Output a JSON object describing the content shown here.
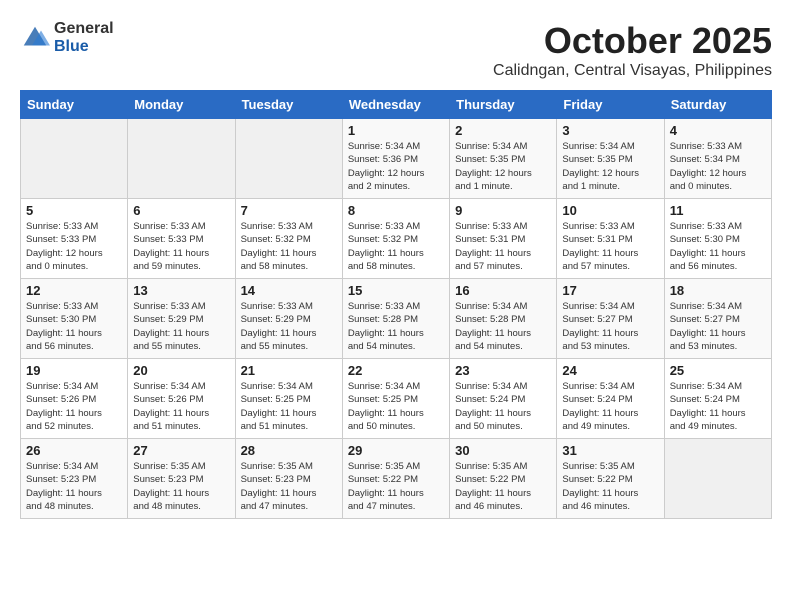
{
  "header": {
    "logo_general": "General",
    "logo_blue": "Blue",
    "month": "October 2025",
    "location": "Calidngan, Central Visayas, Philippines"
  },
  "weekdays": [
    "Sunday",
    "Monday",
    "Tuesday",
    "Wednesday",
    "Thursday",
    "Friday",
    "Saturday"
  ],
  "weeks": [
    [
      {
        "day": "",
        "info": ""
      },
      {
        "day": "",
        "info": ""
      },
      {
        "day": "",
        "info": ""
      },
      {
        "day": "1",
        "info": "Sunrise: 5:34 AM\nSunset: 5:36 PM\nDaylight: 12 hours\nand 2 minutes."
      },
      {
        "day": "2",
        "info": "Sunrise: 5:34 AM\nSunset: 5:35 PM\nDaylight: 12 hours\nand 1 minute."
      },
      {
        "day": "3",
        "info": "Sunrise: 5:34 AM\nSunset: 5:35 PM\nDaylight: 12 hours\nand 1 minute."
      },
      {
        "day": "4",
        "info": "Sunrise: 5:33 AM\nSunset: 5:34 PM\nDaylight: 12 hours\nand 0 minutes."
      }
    ],
    [
      {
        "day": "5",
        "info": "Sunrise: 5:33 AM\nSunset: 5:33 PM\nDaylight: 12 hours\nand 0 minutes."
      },
      {
        "day": "6",
        "info": "Sunrise: 5:33 AM\nSunset: 5:33 PM\nDaylight: 11 hours\nand 59 minutes."
      },
      {
        "day": "7",
        "info": "Sunrise: 5:33 AM\nSunset: 5:32 PM\nDaylight: 11 hours\nand 58 minutes."
      },
      {
        "day": "8",
        "info": "Sunrise: 5:33 AM\nSunset: 5:32 PM\nDaylight: 11 hours\nand 58 minutes."
      },
      {
        "day": "9",
        "info": "Sunrise: 5:33 AM\nSunset: 5:31 PM\nDaylight: 11 hours\nand 57 minutes."
      },
      {
        "day": "10",
        "info": "Sunrise: 5:33 AM\nSunset: 5:31 PM\nDaylight: 11 hours\nand 57 minutes."
      },
      {
        "day": "11",
        "info": "Sunrise: 5:33 AM\nSunset: 5:30 PM\nDaylight: 11 hours\nand 56 minutes."
      }
    ],
    [
      {
        "day": "12",
        "info": "Sunrise: 5:33 AM\nSunset: 5:30 PM\nDaylight: 11 hours\nand 56 minutes."
      },
      {
        "day": "13",
        "info": "Sunrise: 5:33 AM\nSunset: 5:29 PM\nDaylight: 11 hours\nand 55 minutes."
      },
      {
        "day": "14",
        "info": "Sunrise: 5:33 AM\nSunset: 5:29 PM\nDaylight: 11 hours\nand 55 minutes."
      },
      {
        "day": "15",
        "info": "Sunrise: 5:33 AM\nSunset: 5:28 PM\nDaylight: 11 hours\nand 54 minutes."
      },
      {
        "day": "16",
        "info": "Sunrise: 5:34 AM\nSunset: 5:28 PM\nDaylight: 11 hours\nand 54 minutes."
      },
      {
        "day": "17",
        "info": "Sunrise: 5:34 AM\nSunset: 5:27 PM\nDaylight: 11 hours\nand 53 minutes."
      },
      {
        "day": "18",
        "info": "Sunrise: 5:34 AM\nSunset: 5:27 PM\nDaylight: 11 hours\nand 53 minutes."
      }
    ],
    [
      {
        "day": "19",
        "info": "Sunrise: 5:34 AM\nSunset: 5:26 PM\nDaylight: 11 hours\nand 52 minutes."
      },
      {
        "day": "20",
        "info": "Sunrise: 5:34 AM\nSunset: 5:26 PM\nDaylight: 11 hours\nand 51 minutes."
      },
      {
        "day": "21",
        "info": "Sunrise: 5:34 AM\nSunset: 5:25 PM\nDaylight: 11 hours\nand 51 minutes."
      },
      {
        "day": "22",
        "info": "Sunrise: 5:34 AM\nSunset: 5:25 PM\nDaylight: 11 hours\nand 50 minutes."
      },
      {
        "day": "23",
        "info": "Sunrise: 5:34 AM\nSunset: 5:24 PM\nDaylight: 11 hours\nand 50 minutes."
      },
      {
        "day": "24",
        "info": "Sunrise: 5:34 AM\nSunset: 5:24 PM\nDaylight: 11 hours\nand 49 minutes."
      },
      {
        "day": "25",
        "info": "Sunrise: 5:34 AM\nSunset: 5:24 PM\nDaylight: 11 hours\nand 49 minutes."
      }
    ],
    [
      {
        "day": "26",
        "info": "Sunrise: 5:34 AM\nSunset: 5:23 PM\nDaylight: 11 hours\nand 48 minutes."
      },
      {
        "day": "27",
        "info": "Sunrise: 5:35 AM\nSunset: 5:23 PM\nDaylight: 11 hours\nand 48 minutes."
      },
      {
        "day": "28",
        "info": "Sunrise: 5:35 AM\nSunset: 5:23 PM\nDaylight: 11 hours\nand 47 minutes."
      },
      {
        "day": "29",
        "info": "Sunrise: 5:35 AM\nSunset: 5:22 PM\nDaylight: 11 hours\nand 47 minutes."
      },
      {
        "day": "30",
        "info": "Sunrise: 5:35 AM\nSunset: 5:22 PM\nDaylight: 11 hours\nand 46 minutes."
      },
      {
        "day": "31",
        "info": "Sunrise: 5:35 AM\nSunset: 5:22 PM\nDaylight: 11 hours\nand 46 minutes."
      },
      {
        "day": "",
        "info": ""
      }
    ]
  ]
}
